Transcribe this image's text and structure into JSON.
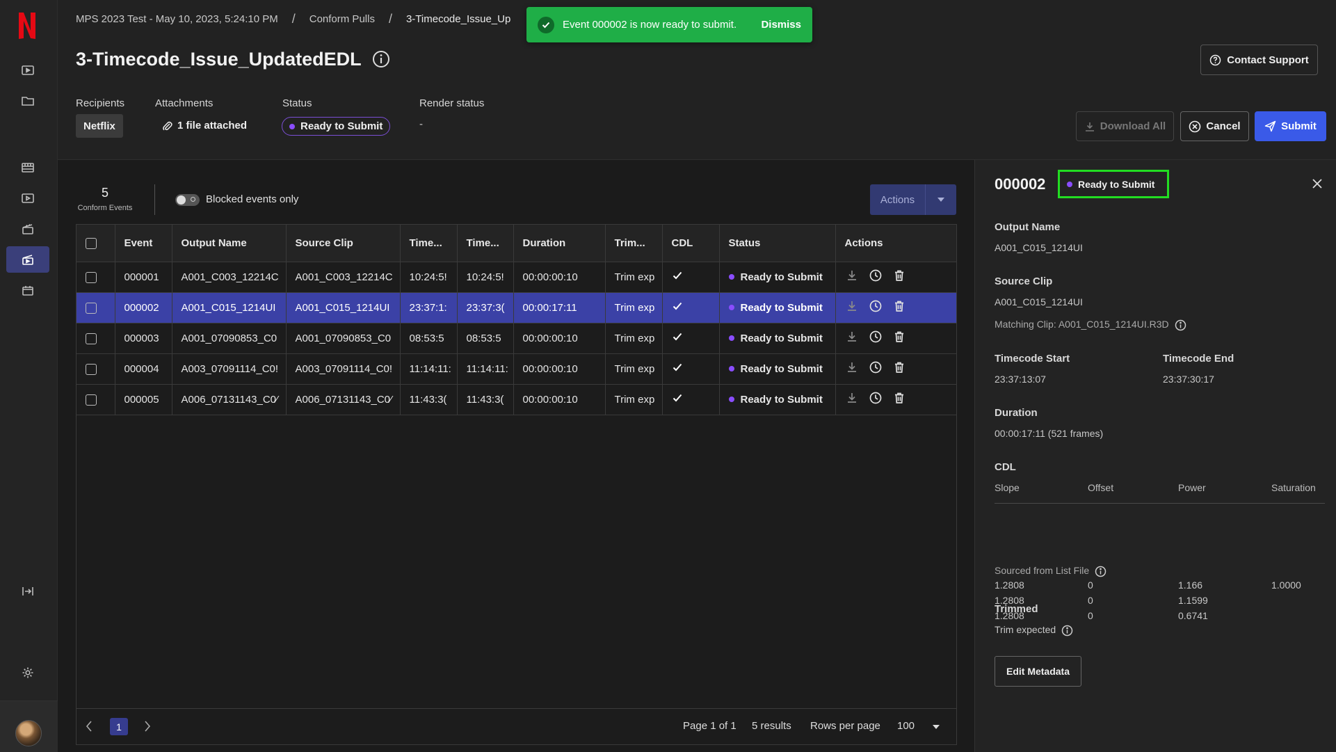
{
  "header": {
    "breadcrumb": [
      "MPS 2023 Test - May 10, 2023, 5:24:10 PM",
      "Conform Pulls",
      "3-Timecode_Issue_Up"
    ],
    "title": "3-Timecode_Issue_UpdatedEDL",
    "contact_support": "Contact Support",
    "recipients_label": "Recipients",
    "recipient": "Netflix",
    "attachments_label": "Attachments",
    "attachments_value": "1 file attached",
    "status_label": "Status",
    "status_value": "Ready to Submit",
    "render_label": "Render status",
    "render_value": "-",
    "download_all": "Download All",
    "cancel": "Cancel",
    "submit": "Submit"
  },
  "toast": {
    "message": "Event 000002 is now ready to submit.",
    "dismiss": "Dismiss"
  },
  "main": {
    "count": "5",
    "count_label": "Conform Events",
    "toggle_label": "Blocked events only",
    "actions_label": "Actions"
  },
  "table": {
    "columns": [
      "Event",
      "Output Name",
      "Source Clip",
      "Time...",
      "Time...",
      "Duration",
      "Trim...",
      "CDL",
      "Status",
      "Actions"
    ],
    "rows": [
      {
        "event": "000001",
        "output": "A001_C003_12214C",
        "source": "A001_C003_12214C",
        "tc1": "10:24:5!",
        "tc2": "10:24:5!",
        "duration": "00:00:00:10",
        "trim": "Trim exp",
        "status": "Ready to Submit"
      },
      {
        "event": "000002",
        "output": "A001_C015_1214UI",
        "source": "A001_C015_1214UI",
        "tc1": "23:37:1:",
        "tc2": "23:37:3(",
        "duration": "00:00:17:11",
        "trim": "Trim exp",
        "status": "Ready to Submit"
      },
      {
        "event": "000003",
        "output": "A001_07090853_C0",
        "source": "A001_07090853_C0",
        "tc1": "08:53:5",
        "tc2": "08:53:5",
        "duration": "00:00:00:10",
        "trim": "Trim exp",
        "status": "Ready to Submit"
      },
      {
        "event": "000004",
        "output": "A003_07091114_C0!",
        "source": "A003_07091114_C0!",
        "tc1": "11:14:11:",
        "tc2": "11:14:11:",
        "duration": "00:00:00:10",
        "trim": "Trim exp",
        "status": "Ready to Submit"
      },
      {
        "event": "000005",
        "output": "A006_07131143_C0⁄",
        "source": "A006_07131143_C0⁄",
        "tc1": "11:43:3(",
        "tc2": "11:43:3(",
        "duration": "00:00:00:10",
        "trim": "Trim exp",
        "status": "Ready to Submit"
      }
    ]
  },
  "pager": {
    "current_page": "1",
    "page_text": "Page 1 of 1",
    "results": "5 results",
    "rows_per_page_label": "Rows per page",
    "rows_per_page": "100"
  },
  "panel": {
    "event_id": "000002",
    "status": "Ready to Submit",
    "output_name_label": "Output Name",
    "output_name": "A001_C015_1214UI",
    "source_clip_label": "Source Clip",
    "source_clip": "A001_C015_1214UI",
    "matching_clip": "Matching Clip: A001_C015_1214UI.R3D",
    "tc_start_label": "Timecode Start",
    "tc_start": "23:37:13:07",
    "tc_end_label": "Timecode End",
    "tc_end": "23:37:30:17",
    "duration_label": "Duration",
    "duration": "00:00:17:11 (521 frames)",
    "cdl_label": "CDL",
    "cdl_cols": [
      "Slope",
      "Offset",
      "Power",
      "Saturation"
    ],
    "cdl_rows": [
      [
        "1.2808",
        "0",
        "1.166",
        "1.0000"
      ],
      [
        "1.2808",
        "0",
        "1.1599",
        ""
      ],
      [
        "1.2808",
        "0",
        "0.6741",
        ""
      ]
    ],
    "sourced_from": "Sourced from List File",
    "trimmed_label": "Trimmed",
    "trimmed_value": "Trim expected",
    "edit_metadata": "Edit Metadata"
  },
  "colors": {
    "accent": "#3a5ae8",
    "status_dot": "#8a4dff",
    "toast": "#1fae47",
    "highlight_box": "#22dd22",
    "selected_row": "#3b41a6"
  }
}
